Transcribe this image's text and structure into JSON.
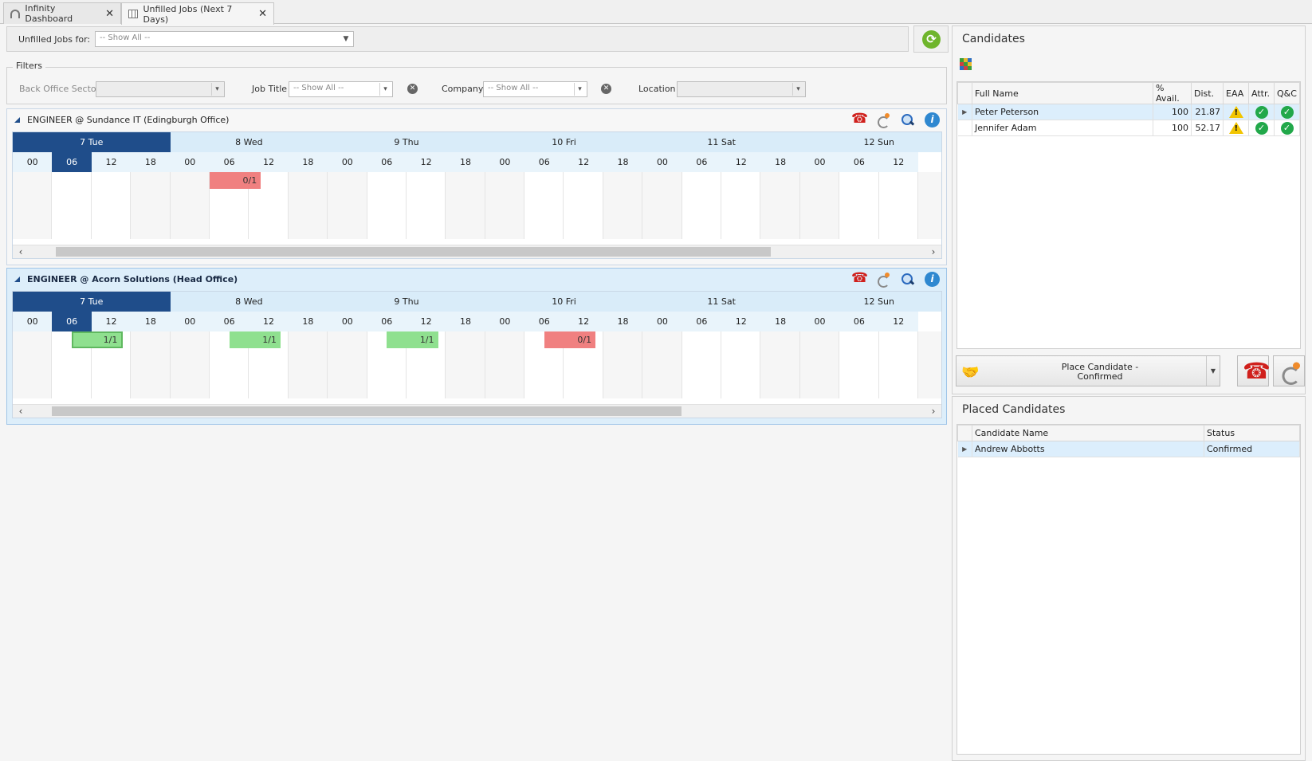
{
  "tabs": [
    {
      "label": "Infinity Dashboard",
      "icon": "dashboard-gauge-icon"
    },
    {
      "label": "Unfilled Jobs (Next 7 Days)",
      "icon": "table-grid-icon"
    }
  ],
  "toolbar": {
    "unfilled_label": "Unfilled Jobs for:",
    "unfilled_value": "-- Show All --"
  },
  "filters": {
    "legend": "Filters",
    "back_office_label": "Back Office Sector",
    "job_title_label": "Job Title",
    "job_title_value": "-- Show All --",
    "company_label": "Company",
    "company_value": "-- Show All --",
    "location_label": "Location"
  },
  "calendar": {
    "days": [
      "7 Tue",
      "8 Wed",
      "9 Thu",
      "10 Fri",
      "11 Sat",
      "12 Sun"
    ],
    "hours": [
      "00",
      "06",
      "12",
      "18",
      "00",
      "06",
      "12",
      "18",
      "00",
      "06",
      "12",
      "18",
      "00",
      "06",
      "12",
      "18",
      "00",
      "06",
      "12",
      "18",
      "00",
      "06",
      "12"
    ]
  },
  "jobs": [
    {
      "title": "ENGINEER @ Sundance IT (Edingburgh Office)",
      "slots": [
        {
          "label": "0/1",
          "status": "unfilled",
          "start_hour_index": 5
        }
      ]
    },
    {
      "title": "ENGINEER @ Acorn Solutions (Head Office)",
      "slots": [
        {
          "label": "1/1",
          "status": "filled",
          "start_hour_index": 1.5
        },
        {
          "label": "1/1",
          "status": "filled",
          "start_hour_index": 5.5
        },
        {
          "label": "1/1",
          "status": "filled",
          "start_hour_index": 9.5
        },
        {
          "label": "0/1",
          "status": "unfilled",
          "start_hour_index": 13.5
        }
      ]
    }
  ],
  "candidates": {
    "title": "Candidates",
    "columns": [
      "Full Name",
      "% Avail.",
      "Dist.",
      "EAA",
      "Attr.",
      "Q&C"
    ],
    "rows": [
      {
        "name": "Peter Peterson",
        "avail": "100",
        "dist": "21.87",
        "eaa": "warning-icon",
        "attr": "check-icon",
        "qc": "check-icon"
      },
      {
        "name": "Jennifer Adam",
        "avail": "100",
        "dist": "52.17",
        "eaa": "warning-icon",
        "attr": "check-icon",
        "qc": "check-icon"
      }
    ]
  },
  "place_button": {
    "line1": "Place Candidate -",
    "line2": "Confirmed"
  },
  "placed": {
    "title": "Placed Candidates",
    "columns": [
      "Candidate Name",
      "Status"
    ],
    "rows": [
      {
        "name": "Andrew Abbotts",
        "status": "Confirmed"
      }
    ]
  },
  "colors": {
    "accent": "#1f4d8a",
    "unfilled": "#f08080",
    "filled": "#8fe08f",
    "refresh": "#6fb52c"
  }
}
